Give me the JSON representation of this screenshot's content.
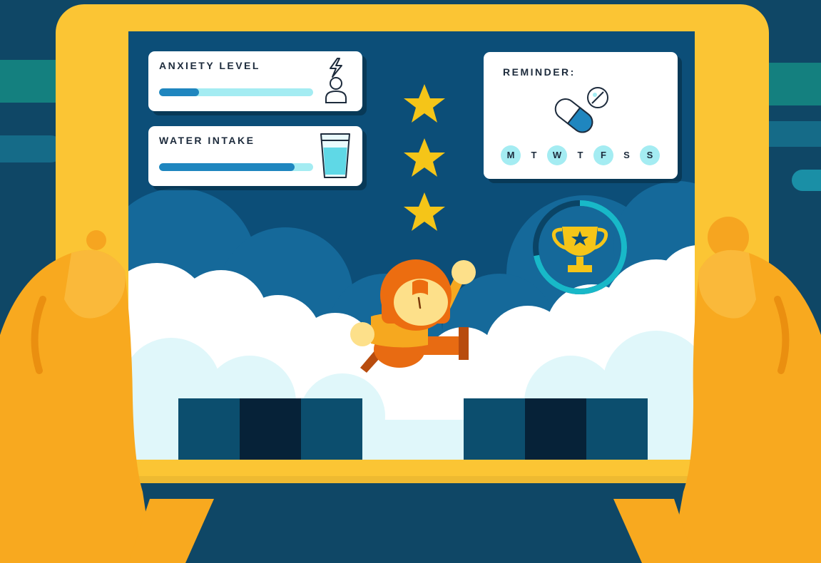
{
  "anxiety": {
    "label": "ANXIETY LEVEL",
    "level": 0.26,
    "icon": "person-stress-icon"
  },
  "water": {
    "label": "WATER INTAKE",
    "level": 0.88,
    "icon": "water-glass-icon"
  },
  "reminder": {
    "label": "REMINDER:",
    "icon": "pill-icon",
    "days": [
      {
        "letter": "M",
        "active": true
      },
      {
        "letter": "T",
        "active": false
      },
      {
        "letter": "W",
        "active": true
      },
      {
        "letter": "T",
        "active": false
      },
      {
        "letter": "F",
        "active": true
      },
      {
        "letter": "S",
        "active": false
      },
      {
        "letter": "S",
        "active": true
      }
    ]
  },
  "stars": {
    "count": 3,
    "icon": "star-icon"
  },
  "trophy": {
    "progress": 0.72,
    "icon": "trophy-icon"
  },
  "colors": {
    "background": "#0f4766",
    "tablet": "#fbc534",
    "hands": "#f8a91f",
    "screen": "#0c4e78",
    "accent_light": "#a4ecf2",
    "accent_dark": "#1f86bf",
    "star": "#f5c518"
  }
}
